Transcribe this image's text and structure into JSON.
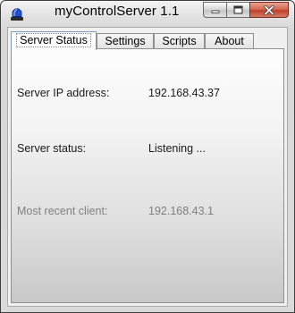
{
  "window": {
    "title": "myControlServer 1.1"
  },
  "tabs": [
    {
      "label": "Server Status",
      "active": true
    },
    {
      "label": "Settings",
      "active": false
    },
    {
      "label": "Scripts",
      "active": false
    },
    {
      "label": "About",
      "active": false
    }
  ],
  "status": {
    "ip_label": "Server IP address:",
    "ip_value": "192.168.43.37",
    "status_label": "Server status:",
    "status_value": "Listening ...",
    "client_label": "Most recent client:",
    "client_value": "192.168.43.1"
  },
  "icons": {
    "app": "alarm-light-icon",
    "minimize": "minimize-icon",
    "maximize": "maximize-icon",
    "close": "close-icon"
  }
}
